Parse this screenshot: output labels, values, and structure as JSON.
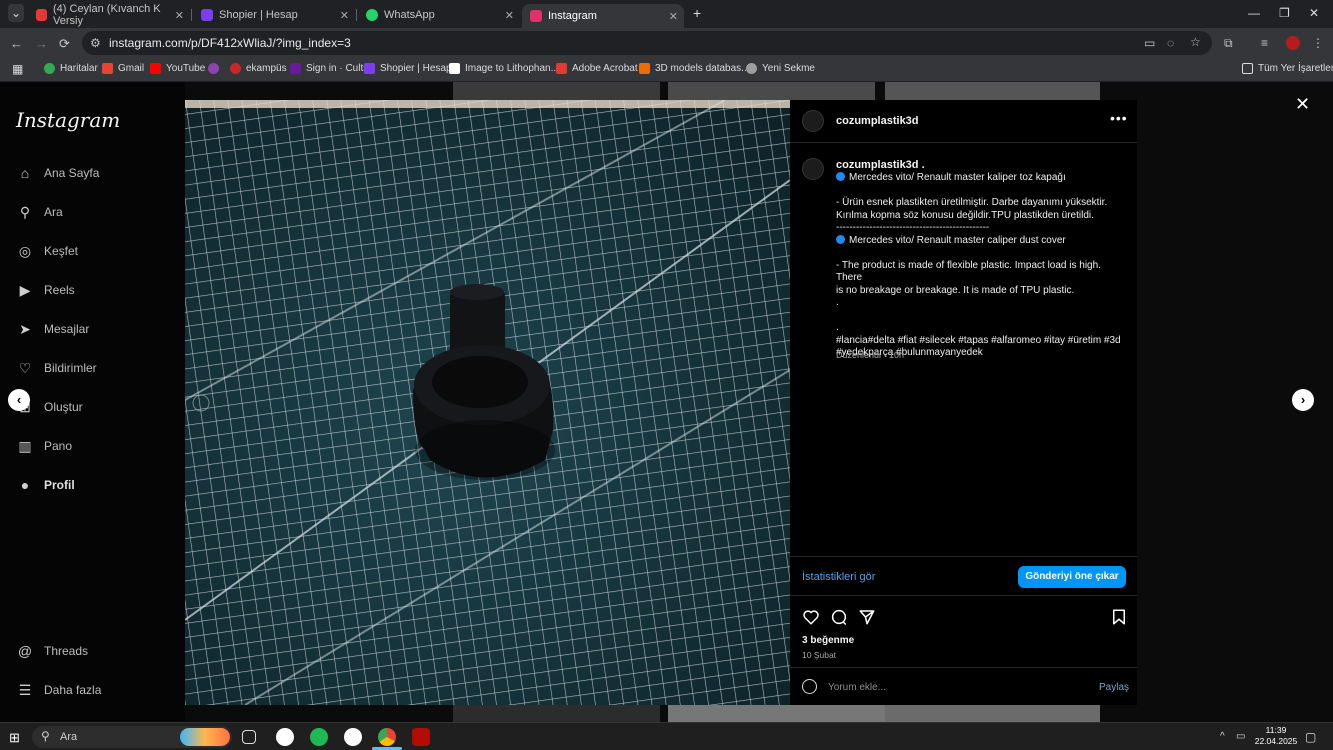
{
  "browser": {
    "tabs": [
      {
        "title": "(4) Ceylan (Kıvanch K Versiy",
        "color": "#e53935",
        "active": false
      },
      {
        "title": "Shopier | Hesap",
        "color": "#7b3ff2",
        "active": false
      },
      {
        "title": "WhatsApp",
        "color": "#25d366",
        "active": false
      },
      {
        "title": "Instagram",
        "color": "#e1306c",
        "active": true
      }
    ],
    "url": "instagram.com/p/DF412xWliaJ/?img_index=3",
    "bookmarks": [
      {
        "label": "Haritalar",
        "color": "#34a853"
      },
      {
        "label": "Gmail",
        "color": "#ea4335"
      },
      {
        "label": "YouTube",
        "color": "#ff0000"
      },
      {
        "label": "",
        "color": "#8e44ad"
      },
      {
        "label": "ekampüs",
        "color": "#c62828"
      },
      {
        "label": "Sign in · Cults",
        "color": "#6a1b9a"
      },
      {
        "label": "Shopier | Hesap",
        "color": "#7b3ff2"
      },
      {
        "label": "Image to Lithophan...",
        "color": "#ffffff"
      },
      {
        "label": "Adobe Acrobat",
        "color": "#e53935"
      },
      {
        "label": "3D models databas...",
        "color": "#ef6c00"
      },
      {
        "label": "Yeni Sekme",
        "color": "#9e9e9e"
      }
    ],
    "all_bookmarks": "Tüm Yer İşaretleri"
  },
  "instagram": {
    "logo": "Instagram",
    "nav": [
      {
        "label": "Ana Sayfa",
        "icon": "home-icon"
      },
      {
        "label": "Ara",
        "icon": "search-icon"
      },
      {
        "label": "Keşfet",
        "icon": "compass-icon"
      },
      {
        "label": "Reels",
        "icon": "reels-icon"
      },
      {
        "label": "Mesajlar",
        "icon": "messages-icon"
      },
      {
        "label": "Bildirimler",
        "icon": "heart-icon"
      },
      {
        "label": "Oluştur",
        "icon": "plus-icon"
      },
      {
        "label": "Pano",
        "icon": "dashboard-icon"
      },
      {
        "label": "Profil",
        "icon": "profile-icon"
      }
    ],
    "nav_bottom": [
      {
        "label": "Threads",
        "icon": "threads-icon"
      },
      {
        "label": "Daha fazla",
        "icon": "menu-icon"
      }
    ]
  },
  "post": {
    "username": "cozumplastik3d",
    "caption_username": "cozumplastik3d",
    "caption_lines": [
      "Mercedes vito/ Renault master kaliper toz kapağı",
      "",
      "- Ürün esnek plastikten üretilmiştir. Darbe dayanımı yüksektir.",
      "Kırılma kopma söz konusu değildir.TPU plastikden üretildi.",
      "----------------------------------------------",
      "Mercedes vito/ Renault master caliper dust cover",
      "",
      "- The product is made of flexible plastic. Impact load is high. There",
      "is no breakage or breakage. It is made of TPU plastic.",
      ".",
      "",
      ".",
      "#lancia#delta #fiat #silecek #tapas #alfaromeo #itay #üretim #3d",
      "#yedekparça #bulunmayanyedek"
    ],
    "edited": "Düzenlendi · 10h",
    "insights": "İstatistikleri gör",
    "boost": "Gönderiyi öne çıkar",
    "likes": "3 beğenme",
    "date": "10 Şubat",
    "comment_placeholder": "Yorum ekle...",
    "share": "Paylaş"
  },
  "taskbar": {
    "search": "Ara",
    "time": "11:39",
    "date": "22.04.2025"
  }
}
